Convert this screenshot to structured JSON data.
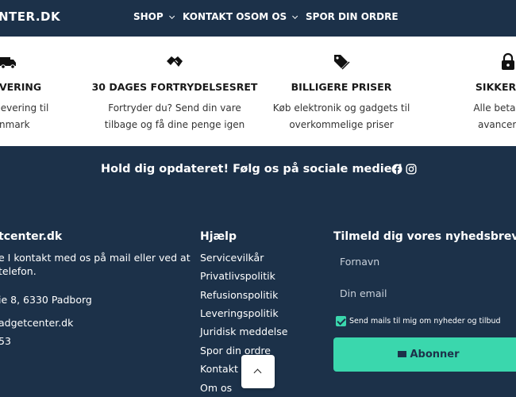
{
  "header": {
    "logo": "NTER.DK",
    "nav": [
      "SHOP",
      "KONTAKT OS",
      "OM OS",
      "SPOR DIN ORDRE"
    ]
  },
  "features": [
    {
      "icon": "truck-icon",
      "title": "G LEVERING",
      "desc1": "ksibel levering til",
      "desc2": "Danmark"
    },
    {
      "icon": "handshake-icon",
      "title": "30 DAGES FORTRYDELSESRET",
      "desc1": "Fortryder du? Send din vare",
      "desc2": "tilbage og få dine penge igen"
    },
    {
      "icon": "price-tag-icon",
      "title": "BILLIGERE PRISER",
      "desc1": "Køb elektronik og gadgets til",
      "desc2": "overkommelige priser"
    },
    {
      "icon": "lock-icon",
      "title": "SIKKER BET",
      "desc1": "Alle betalinger",
      "desc2": "avanceret te"
    }
  ],
  "social": {
    "text": "Hold dig opdateret! Følg os på sociale medier!",
    "icons": [
      "facebook-icon",
      "instagram-icon"
    ]
  },
  "company": {
    "title": "tcenter.dk",
    "line1": "e I kontakt med os på mail eller ved at",
    "line2": "telefon.",
    "address": "ie 8, 6330 Padborg",
    "email": "adgetcenter.dk",
    "phone": "53"
  },
  "help": {
    "title": "Hjælp",
    "links": [
      "Servicevilkår",
      "Privatlivspolitik",
      "Refusionspolitik",
      "Leveringspolitik",
      "Juridisk meddelse",
      "Spor din ordre",
      "Kontakt o",
      "Om os"
    ]
  },
  "newsletter": {
    "title": "Tilmeld dig vores nyhedsbrev",
    "firstname_placeholder": "Fornavn",
    "email_placeholder": "Din email",
    "consent": "Send mails til mig om nyheder og tilbud",
    "button": "Abonner"
  },
  "colors": {
    "navy": "#1c3149",
    "accent": "#3ad7ad",
    "white": "#ffffff"
  }
}
